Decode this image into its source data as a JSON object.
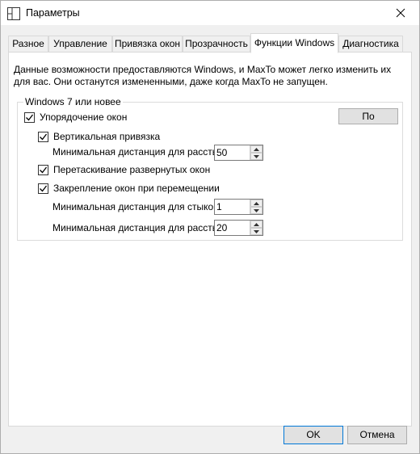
{
  "window": {
    "title": "Параметры"
  },
  "tabs": [
    {
      "label": "Разное"
    },
    {
      "label": "Управление"
    },
    {
      "label": "Привязка окон"
    },
    {
      "label": "Прозрачность"
    },
    {
      "label": "Функции Windows",
      "active": true
    },
    {
      "label": "Диагностика"
    }
  ],
  "description": "Данные возможности предоставляются Windows, и MaxTo может легко изменить их для вас. Они останутся измененными, даже когда MaxTo не запущен.",
  "group": {
    "label": "Windows 7 или новее",
    "arrange": {
      "label": "Упорядочение окон",
      "checked": true
    },
    "button_label": "По",
    "vertical_snap": {
      "label": "Вертикальная привязка",
      "checked": true
    },
    "vertical_distance": {
      "label": "Минимальная дистанция для расстыко",
      "value": "50"
    },
    "drag_maximized": {
      "label": "Перетаскивание развернутых окон",
      "checked": true
    },
    "docking": {
      "label": "Закрепление окон при перемещении",
      "checked": true
    },
    "dock_distance": {
      "label": "Минимальная дистанция для стыковки",
      "value": "1"
    },
    "undock_distance": {
      "label": "Минимальная дистанция для расстыко",
      "value": "20"
    }
  },
  "footer": {
    "ok_label": "OK",
    "cancel_label": "Отмена"
  },
  "colors": {
    "accent": "#0078d7",
    "panel": "#ffffff",
    "window": "#f0f0f0"
  }
}
